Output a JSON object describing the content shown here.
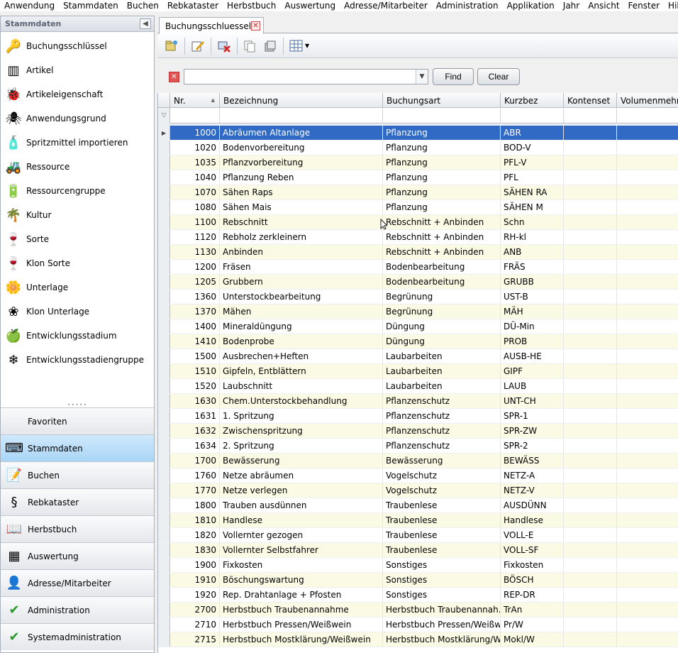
{
  "menu": [
    "Anwendung",
    "Stammdaten",
    "Buchen",
    "Rebkataster",
    "Herbstbuch",
    "Auswertung",
    "Adresse/Mitarbeiter",
    "Administration",
    "Applikation",
    "Jahr",
    "Ansicht",
    "Fenster",
    "Hilfe"
  ],
  "left_panel": {
    "title": "Stammdaten",
    "items": [
      {
        "label": "Buchungsschlüssel",
        "icon": "key-icon"
      },
      {
        "label": "Artikel",
        "icon": "barcode-icon"
      },
      {
        "label": "Artikeleigenschaft",
        "icon": "ladybug-icon"
      },
      {
        "label": "Anwendungsgrund",
        "icon": "spider-icon"
      },
      {
        "label": "Spritzmittel importieren",
        "icon": "bottle-icon"
      },
      {
        "label": "Ressource",
        "icon": "tractor-icon"
      },
      {
        "label": "Ressourcengruppe",
        "icon": "battery-icon"
      },
      {
        "label": "Kultur",
        "icon": "palm-tree-icon"
      },
      {
        "label": "Sorte",
        "icon": "wine-glass-icon"
      },
      {
        "label": "Klon Sorte",
        "icon": "wine-glass-icon"
      },
      {
        "label": "Unterlage",
        "icon": "sun-flower-icon"
      },
      {
        "label": "Klon Unterlage",
        "icon": "flower-icon"
      },
      {
        "label": "Entwicklungsstadium",
        "icon": "apple-icon"
      },
      {
        "label": "Entwicklungsstadiengruppe",
        "icon": "snowflake-icon"
      }
    ],
    "groups": [
      {
        "label": "Favoriten",
        "icon": "",
        "active": false
      },
      {
        "label": "Stammdaten",
        "icon": "keyboard-icon",
        "active": true
      },
      {
        "label": "Buchen",
        "icon": "notepad-icon",
        "active": false
      },
      {
        "label": "Rebkataster",
        "icon": "law-book-icon",
        "active": false
      },
      {
        "label": "Herbstbuch",
        "icon": "open-book-icon",
        "active": false
      },
      {
        "label": "Auswertung",
        "icon": "grid-icon",
        "active": false
      },
      {
        "label": "Adresse/Mitarbeiter",
        "icon": "person-icon",
        "active": false
      },
      {
        "label": "Administration",
        "icon": "check-icon",
        "active": false
      },
      {
        "label": "Systemadministration",
        "icon": "check-icon",
        "active": false
      }
    ]
  },
  "tab": {
    "label": "Buchungsschluessel"
  },
  "filter": {
    "value": "",
    "find_label": "Find",
    "clear_label": "Clear"
  },
  "columns": [
    "Nr.",
    "Bezeichnung",
    "Buchungsart",
    "Kurzbez",
    "Kontenset",
    "Volumenmehrung"
  ],
  "rows": [
    [
      "1000",
      "Abräumen Altanlage",
      "Pflanzung",
      "ABR"
    ],
    [
      "1020",
      "Bodenvorbereitung",
      "Pflanzung",
      "BOD-V"
    ],
    [
      "1035",
      "Pflanzvorbereitung",
      "Pflanzung",
      "PFL-V"
    ],
    [
      "1040",
      "Pflanzung Reben",
      "Pflanzung",
      "PFL"
    ],
    [
      "1070",
      "Sähen Raps",
      "Pflanzung",
      "SÄHEN RA"
    ],
    [
      "1080",
      "Sähen Mais",
      "Pflanzung",
      "SÄHEN M"
    ],
    [
      "1100",
      "Rebschnitt",
      "Rebschnitt + Anbinden",
      "Schn"
    ],
    [
      "1120",
      "Rebholz zerkleinern",
      "Rebschnitt + Anbinden",
      "RH-kl"
    ],
    [
      "1130",
      "Anbinden",
      "Rebschnitt + Anbinden",
      "ANB"
    ],
    [
      "1200",
      "Fräsen",
      "Bodenbearbeitung",
      "FRÄS"
    ],
    [
      "1205",
      "Grubbern",
      "Bodenbearbeitung",
      "GRUBB"
    ],
    [
      "1360",
      "Unterstockbearbeitung",
      "Begrünung",
      "UST-B"
    ],
    [
      "1370",
      "Mähen",
      "Begrünung",
      "MÄH"
    ],
    [
      "1400",
      "Mineraldüngung",
      "Düngung",
      "DÜ-Min"
    ],
    [
      "1410",
      "Bodenprobe",
      "Düngung",
      "PROB"
    ],
    [
      "1500",
      "Ausbrechen+Heften",
      "Laubarbeiten",
      "AUSB-HE"
    ],
    [
      "1510",
      "Gipfeln, Entblättern",
      "Laubarbeiten",
      "GIPF"
    ],
    [
      "1520",
      "Laubschnitt",
      "Laubarbeiten",
      "LAUB"
    ],
    [
      "1630",
      "Chem.Unterstockbehandlung",
      "Pflanzenschutz",
      "UNT-CH"
    ],
    [
      "1631",
      "1. Spritzung",
      "Pflanzenschutz",
      "SPR-1"
    ],
    [
      "1632",
      "Zwischenspritzung",
      "Pflanzenschutz",
      "SPR-ZW"
    ],
    [
      "1634",
      "2. Spritzung",
      "Pflanzenschutz",
      "SPR-2"
    ],
    [
      "1700",
      "Bewässerung",
      "Bewässerung",
      "BEWÄSS"
    ],
    [
      "1760",
      "Netze abräumen",
      "Vogelschutz",
      "NETZ-A"
    ],
    [
      "1770",
      "Netze verlegen",
      "Vogelschutz",
      "NETZ-V"
    ],
    [
      "1800",
      "Trauben ausdünnen",
      "Traubenlese",
      "AUSDÜNN"
    ],
    [
      "1810",
      "Handlese",
      "Traubenlese",
      "Handlese"
    ],
    [
      "1820",
      "Vollernter gezogen",
      "Traubenlese",
      "VOLL-E"
    ],
    [
      "1830",
      "Vollernter Selbstfahrer",
      "Traubenlese",
      "VOLL-SF"
    ],
    [
      "1900",
      "Fixkosten",
      "Sonstiges",
      "Fixkosten"
    ],
    [
      "1910",
      "Böschungswartung",
      "Sonstiges",
      "BÖSCH"
    ],
    [
      "1920",
      "Rep. Drahtanlage + Pfosten",
      "Sonstiges",
      "REP-DR"
    ],
    [
      "2700",
      "Herbstbuch Traubenannahme",
      "Herbstbuch Traubenannah...",
      "TrAn"
    ],
    [
      "2710",
      "Herbstbuch Pressen/Weißwein",
      "Herbstbuch Pressen/Weißw...",
      "Pr/W"
    ],
    [
      "2715",
      "Herbstbuch Mostklärung/Weißwein",
      "Herbstbuch Mostklärung/W...",
      "Mokl/W"
    ]
  ],
  "selected_row": 0
}
